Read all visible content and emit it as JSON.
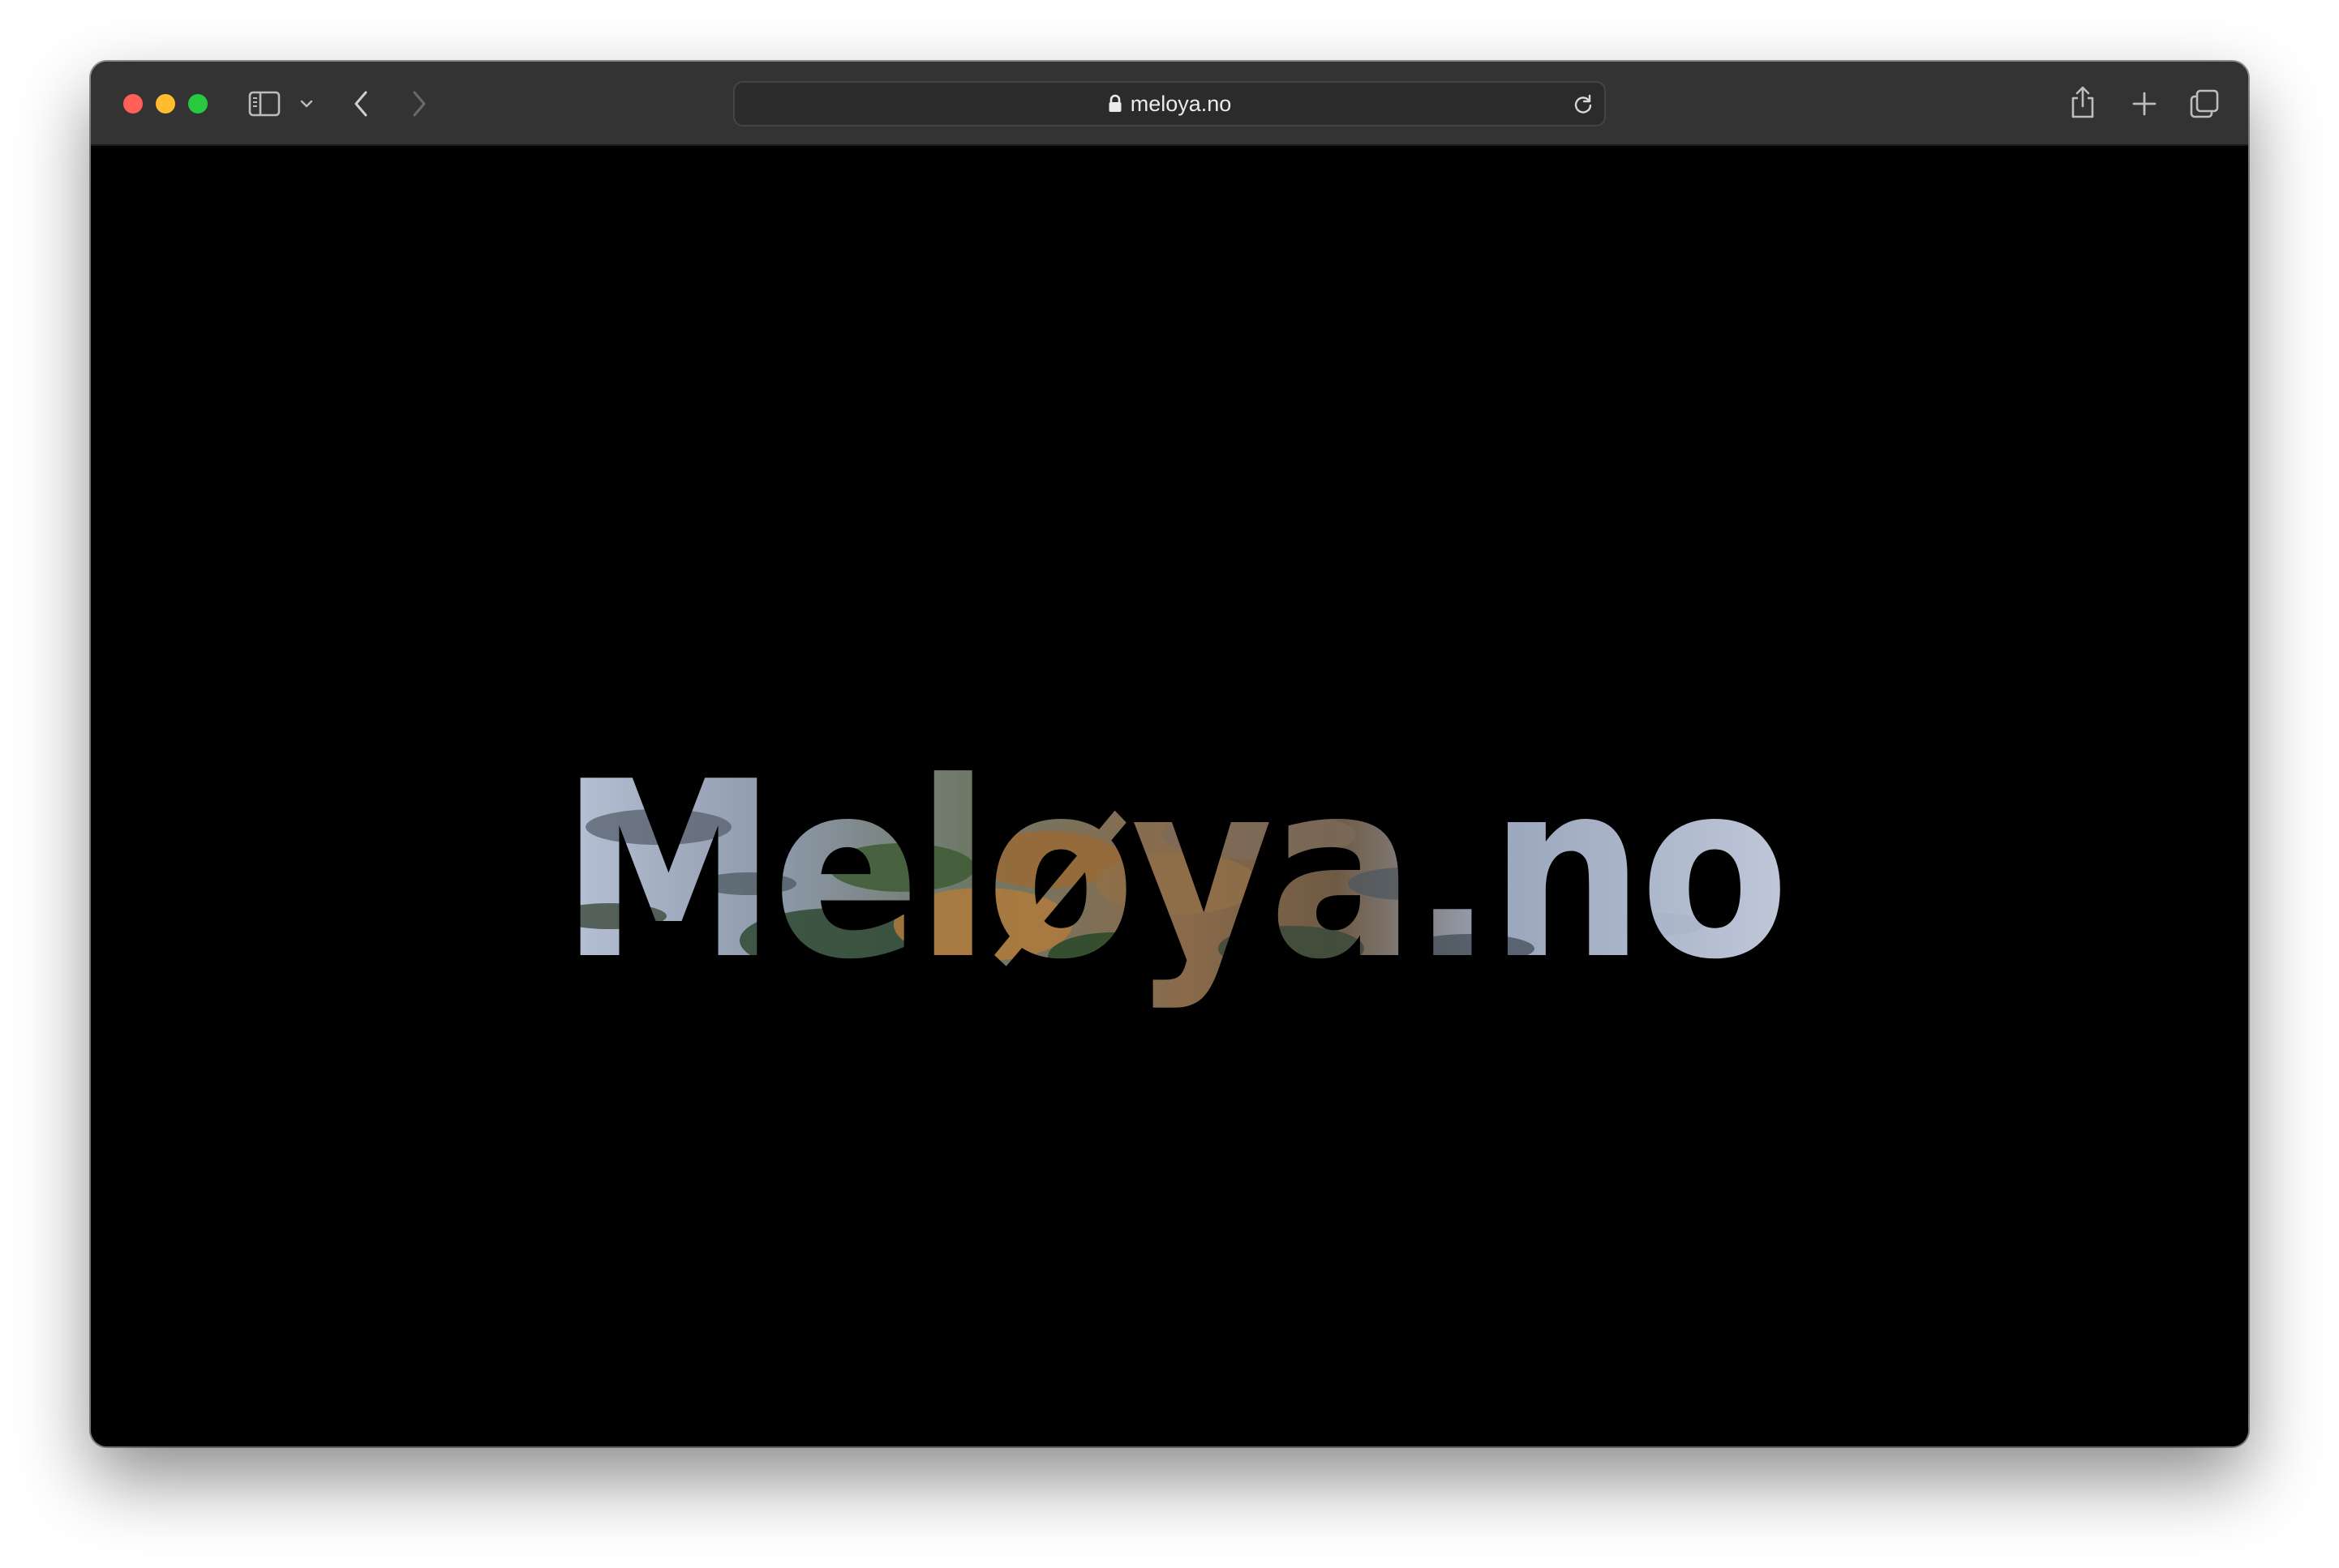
{
  "browser": {
    "url": "meloya.no",
    "colors": {
      "close": "#ff5f57",
      "minimize": "#febc2e",
      "zoom": "#28c840"
    },
    "icons": {
      "sidebar": "sidebar-icon",
      "sidebar_menu": "chevron-down-icon",
      "back": "chevron-left-icon",
      "forward": "chevron-right-icon",
      "lock": "lock-icon",
      "reload": "reload-icon",
      "share": "share-icon",
      "new_tab": "plus-icon",
      "tabs": "tab-overview-icon"
    }
  },
  "page": {
    "hero_title": "Meløya.no",
    "background": "#000000"
  }
}
